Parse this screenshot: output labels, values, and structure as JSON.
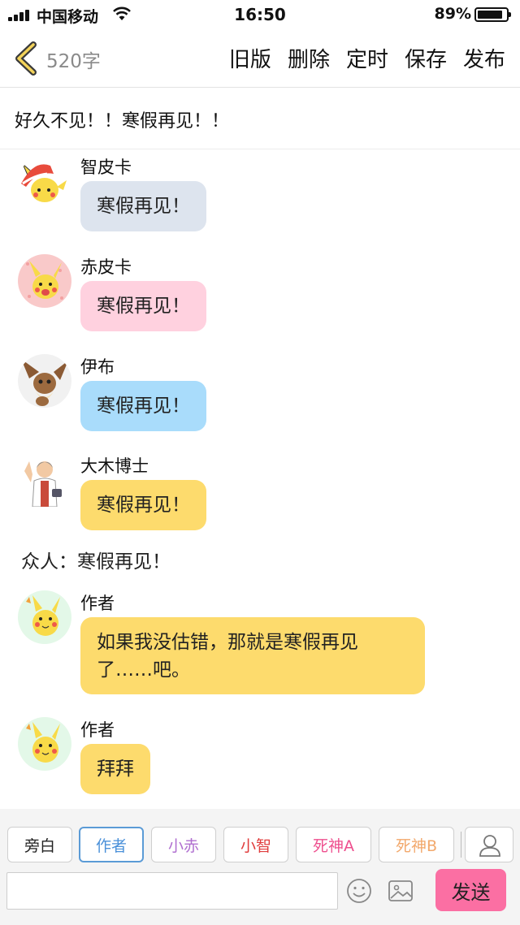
{
  "status_bar": {
    "carrier": "中国移动",
    "time": "16:50",
    "battery": "89%",
    "battery_level": 0.89
  },
  "header": {
    "char_count": "520字",
    "actions": [
      "旧版",
      "删除",
      "定时",
      "保存",
      "发布"
    ]
  },
  "story_title": "好久不见！！寒假再见！！",
  "messages": [
    {
      "sender": "智皮卡",
      "text": "寒假再见！",
      "color": "#dde4ee",
      "avatar_icon": "pikachu-cap-avatar-icon"
    },
    {
      "sender": "赤皮卡",
      "text": "寒假再见！",
      "color": "#ffd1df",
      "avatar_icon": "pikachu-pink-avatar-icon"
    },
    {
      "sender": "伊布",
      "text": "寒假再见！",
      "color": "#a9dcfb",
      "avatar_icon": "eevee-avatar-icon"
    },
    {
      "sender": "大木博士",
      "text": "寒假再见！",
      "color": "#fddb6d",
      "avatar_icon": "professor-avatar-icon"
    }
  ],
  "narration": "众人：寒假再见！",
  "author_messages": [
    {
      "sender": "作者",
      "text_line1": "如果我没估错，那就是寒假再见",
      "text_line2": "了……吧。",
      "color": "#fddb6d",
      "avatar_icon": "pikachu-author-avatar-icon"
    },
    {
      "sender": "作者",
      "text": "拜拜",
      "color": "#fddb6d",
      "avatar_icon": "pikachu-author-avatar-icon"
    }
  ],
  "role_buttons": [
    {
      "label": "旁白",
      "color": "#222222"
    },
    {
      "label": "作者",
      "color": "#4a90d9",
      "active": true
    },
    {
      "label": "小赤",
      "color": "#b06fd0"
    },
    {
      "label": "小智",
      "color": "#e03c3c"
    },
    {
      "label": "死神A",
      "color": "#ee4f8e"
    },
    {
      "label": "死神B",
      "color": "#f2a86b"
    }
  ],
  "input": {
    "value": "",
    "placeholder": ""
  },
  "send_label": "发送",
  "colors": {
    "accent_send": "#fb6fa3",
    "active_role_border": "#5b9bd6"
  }
}
